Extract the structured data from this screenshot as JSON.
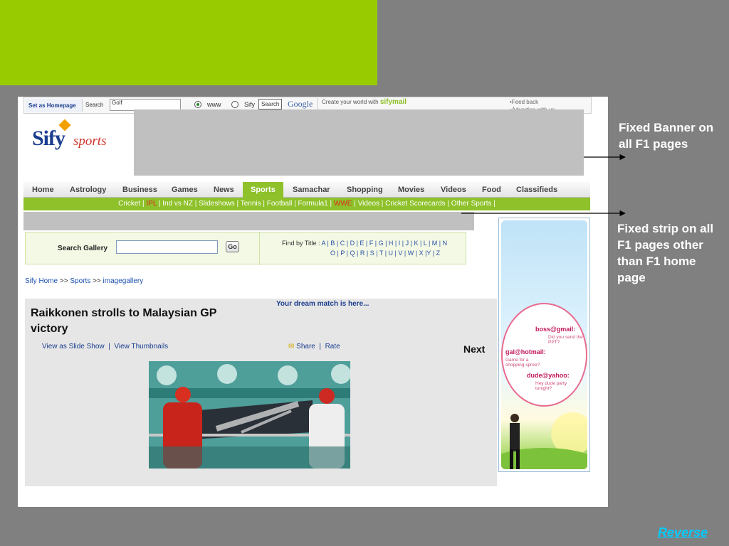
{
  "topbar": {
    "set_homepage": "Set as Homepage",
    "search_label": "Search",
    "search_value": "Golf",
    "radio_www": "www",
    "radio_sify": "Sify",
    "search_button": "Search",
    "google": "Google",
    "create_prefix": "Create your world with",
    "create_brand": "sifymail",
    "feedback": "•Feed back",
    "advertise": "•Advertise with us"
  },
  "logo": {
    "sify": "Sify",
    "sports": "sports"
  },
  "nav": {
    "items": [
      "Home",
      "Astrology",
      "Business",
      "Games",
      "News",
      "Sports",
      "Samachar",
      "Shopping",
      "Movies",
      "Videos",
      "Food",
      "Classifieds"
    ],
    "active": "Sports"
  },
  "subnav": {
    "items": [
      "Cricket",
      "IPL",
      "Ind vs NZ",
      "Slideshows",
      "Tennis",
      "Football",
      "Formula1",
      "WWE",
      "Videos",
      "Cricket Scorecards",
      "Other Sports"
    ],
    "highlighted": [
      "IPL",
      "WWE"
    ]
  },
  "gallery": {
    "label": "Search Gallery",
    "go": "Go",
    "find_label": "Find by Title :",
    "letters_row1": "A | B | C | D | E | F | G | H | I | J | K | L | M | N",
    "letters_row2": "O | P | Q | R | S | T | U | V | W | X |Y | Z"
  },
  "breadcrumb": [
    "Sify Home",
    "Sports",
    "imagegallery"
  ],
  "content": {
    "title": "Raikkonen strolls to Malaysian GP victory",
    "dream": "Your dream match is here...",
    "slide_show": "View as Slide Show",
    "thumbnails": "View Thumbnails",
    "share": "Share",
    "rate": "Rate",
    "next": "Next"
  },
  "ad": {
    "boss": "boss@gmail:",
    "boss_msg": "Did you send the PPT?",
    "gal": "gal@hotmail:",
    "gal_msg": "Game for a shopping spree?",
    "dude": "dude@yahoo:",
    "dude_msg": "Hey dude party tonight?"
  },
  "notes": {
    "banner_note": "Fixed Banner on all F1 pages",
    "strip_note": "Fixed strip on all F1 pages other than F1 home page",
    "reverse": "Reverse"
  },
  "colors": {
    "slide_bg": "#808080",
    "accent_green": "#99cc00",
    "nav_green": "#8ec12a",
    "link_blue": "#1a3d8f",
    "reverse": "#00ccff"
  }
}
